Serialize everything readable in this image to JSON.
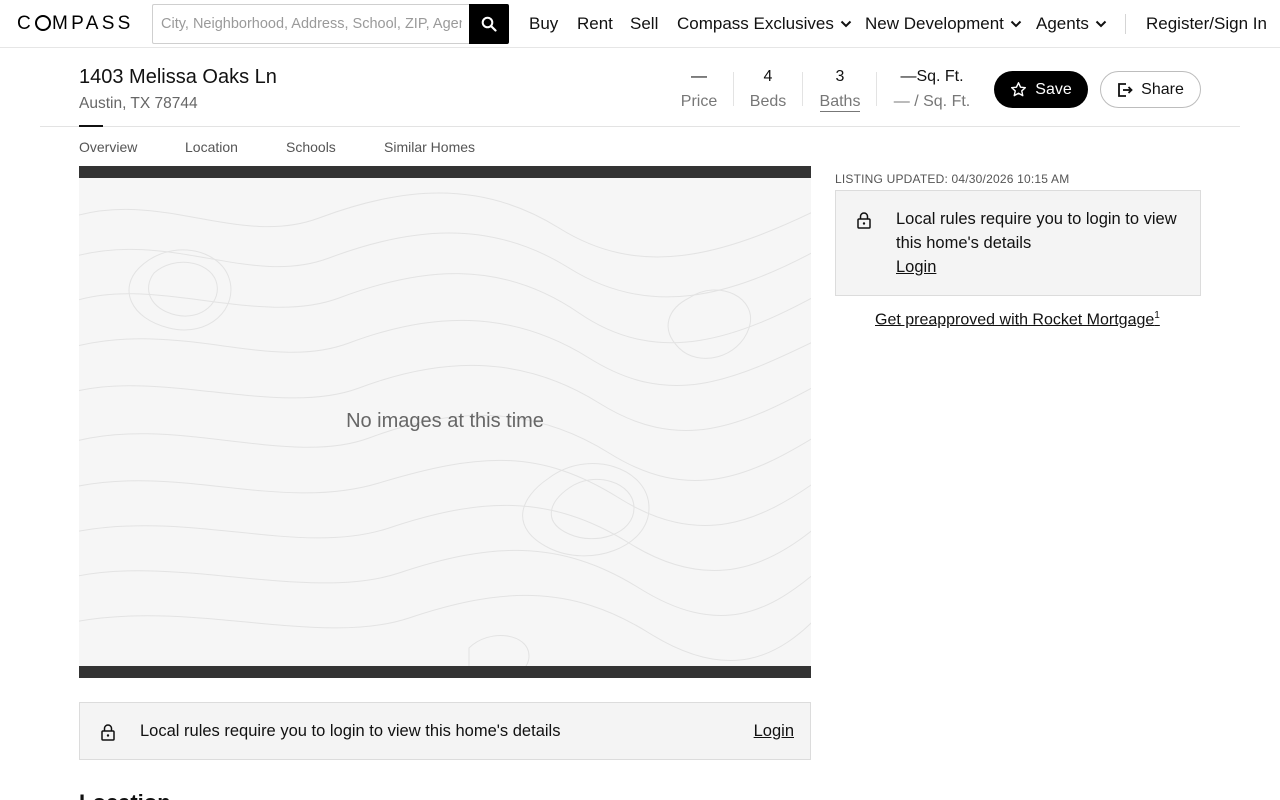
{
  "nav": {
    "logo": "COMPASS",
    "search_placeholder": "City, Neighborhood, Address, School, ZIP, Agent",
    "items": [
      {
        "label": "Buy"
      },
      {
        "label": "Rent"
      },
      {
        "label": "Sell"
      },
      {
        "label": "Compass Exclusives"
      },
      {
        "label": "New Development"
      },
      {
        "label": "Agents"
      }
    ],
    "signin": "Register/Sign In"
  },
  "listing": {
    "address": "1403 Melissa Oaks Ln",
    "city": "Austin, TX 78744",
    "stats": {
      "price_value": "—",
      "price_label": "Price",
      "beds_value": "4",
      "beds_label": "Beds",
      "baths_value": "3",
      "baths_label": "Baths",
      "sqft_value": "—Sq. Ft.",
      "sqft_label": "— / Sq. Ft."
    },
    "save_label": "Save",
    "share_label": "Share"
  },
  "tabs": [
    {
      "label": "Overview",
      "active": true
    },
    {
      "label": "Location"
    },
    {
      "label": "Schools"
    },
    {
      "label": "Similar Homes"
    }
  ],
  "media": {
    "empty_text": "No images at this time"
  },
  "notice": {
    "text_long": "Local rules require you to login to view this home's details",
    "login": "Login"
  },
  "sidebar": {
    "updated": "LISTING UPDATED: 04/30/2026 10:15 AM",
    "notice_text": "Local rules require you to login to view this home's details",
    "login": "Login",
    "mortgage": "Get preapproved with Rocket Mortgage",
    "mortgage_sup": "1"
  },
  "section_peek": "Location",
  "colors": {
    "accent": "#000000",
    "notice_bg": "#f4f4f4",
    "media_bg": "#f6f6f6"
  }
}
